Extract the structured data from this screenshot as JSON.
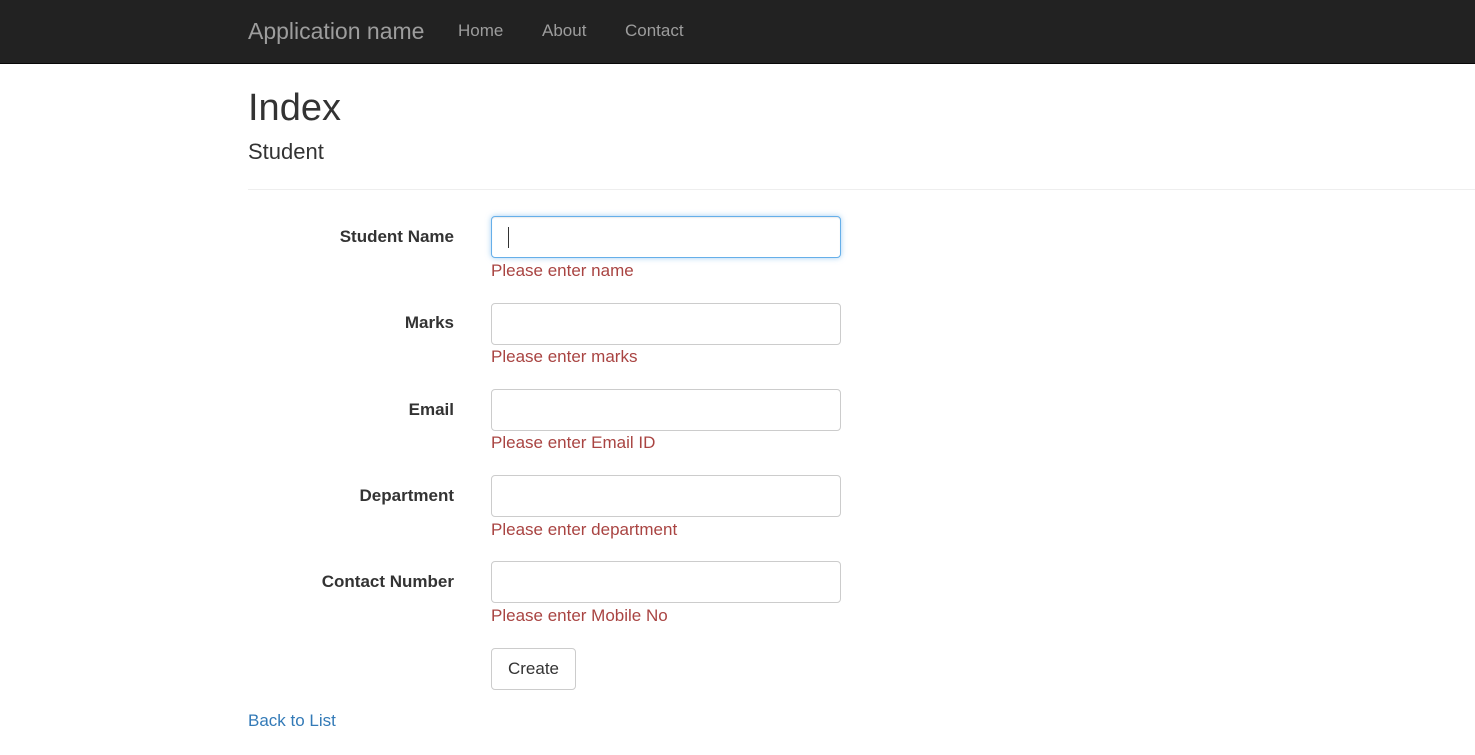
{
  "navbar": {
    "brand": "Application name",
    "links": [
      "Home",
      "About",
      "Contact"
    ],
    "background": "#222222",
    "link_color": "#9d9d9d"
  },
  "page": {
    "title": "Index",
    "subtitle": "Student"
  },
  "form": {
    "fields": [
      {
        "label": "Student Name",
        "value": "",
        "error": "Please enter name",
        "focused": true
      },
      {
        "label": "Marks",
        "value": "",
        "error": "Please enter marks"
      },
      {
        "label": "Email",
        "value": "",
        "error": "Please enter Email ID"
      },
      {
        "label": "Department",
        "value": "",
        "error": "Please enter department"
      },
      {
        "label": "Contact Number",
        "value": "",
        "error": "Please enter Mobile No"
      }
    ],
    "submit_label": "Create",
    "error_color": "#a94442"
  },
  "footer": {
    "back_link": "Back to List",
    "link_color": "#337ab7"
  }
}
